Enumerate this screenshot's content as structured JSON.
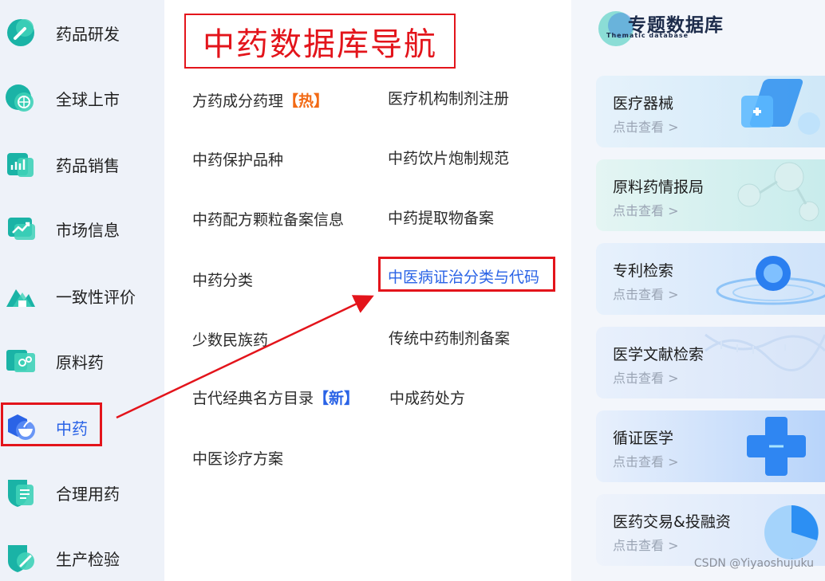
{
  "sidebar": {
    "items": [
      {
        "label": "药品研发",
        "icon": "flask-icon"
      },
      {
        "label": "全球上市",
        "icon": "globe-icon"
      },
      {
        "label": "药品销售",
        "icon": "sales-chart-icon"
      },
      {
        "label": "市场信息",
        "icon": "trend-chart-icon"
      },
      {
        "label": "一致性评价",
        "icon": "mountain-icon"
      },
      {
        "label": "原料药",
        "icon": "ingredient-icon"
      },
      {
        "label": "中药",
        "icon": "herb-bowl-icon",
        "active": true
      },
      {
        "label": "合理用药",
        "icon": "shield-doc-icon"
      },
      {
        "label": "生产检验",
        "icon": "pencil-shield-icon"
      }
    ]
  },
  "main": {
    "title": "中药数据库导航",
    "links_left": [
      {
        "label": "方药成分药理",
        "tag": "【热】"
      },
      {
        "label": "中药保护品种"
      },
      {
        "label": "中药配方颗粒备案信息"
      },
      {
        "label": "中药分类"
      },
      {
        "label": "少数民族药"
      },
      {
        "label": "古代经典名方目录",
        "tag": "【新】"
      },
      {
        "label": "中医诊疗方案"
      }
    ],
    "links_right": [
      {
        "label": "医疗机构制剂注册"
      },
      {
        "label": "中药饮片炮制规范"
      },
      {
        "label": "中药提取物备案"
      },
      {
        "label": "中医病证治分类与代码",
        "highlighted": true
      },
      {
        "label": "传统中药制剂备案"
      },
      {
        "label": "中成药处方"
      }
    ]
  },
  "right_panel": {
    "title": "专题数据库",
    "subtitle": "Thematic database",
    "cards": [
      {
        "title": "医疗器械",
        "sub": "点击查看 >"
      },
      {
        "title": "原料药情报局",
        "sub": "点击查看 >"
      },
      {
        "title": "专利检索",
        "sub": "点击查看 >"
      },
      {
        "title": "医学文献检索",
        "sub": "点击查看 >"
      },
      {
        "title": "循证医学",
        "sub": "点击查看 >"
      },
      {
        "title": "医药交易&投融资",
        "sub": "点击查看 >"
      }
    ]
  },
  "watermark": "CSDN @Yiyaoshujuku",
  "colors": {
    "accent_blue": "#2a63e6",
    "highlight_red": "#e3141b",
    "hot_orange": "#f26a15",
    "icon_teal": "#1ab3a6"
  }
}
